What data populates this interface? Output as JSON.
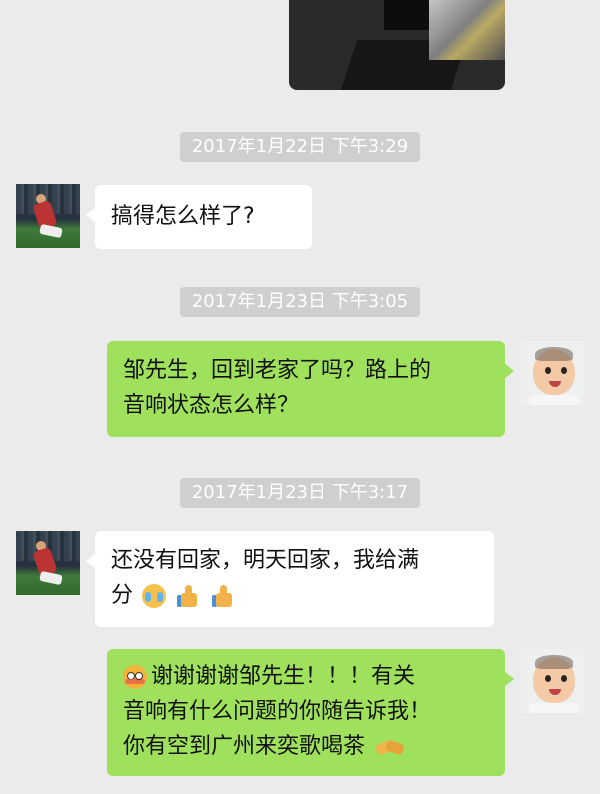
{
  "timestamps": [
    "2017年1月22日 下午3:29",
    "2017年1月23日 下午3:05",
    "2017年1月23日 下午3:17"
  ],
  "messages": [
    {
      "lines": [
        "搞得怎么样了?"
      ]
    },
    {
      "lines": [
        "邹先生，回到老家了吗？路上的",
        "音响状态怎么样？"
      ]
    },
    {
      "lines": [
        "还没有回家，明天回家，我给满",
        "分"
      ],
      "emojis": [
        "crying-laughing-icon",
        "thumbs-up-icon",
        "thumbs-up-icon"
      ]
    },
    {
      "lines": [
        "谢谢谢谢邹先生！！！有关",
        "音响有什么问题的你随告诉我！",
        "你有空到广州来奕歌喝茶"
      ],
      "emojis": [
        "flushed-face-icon",
        "handshake-icon"
      ]
    }
  ],
  "colors": {
    "background": "#ebebeb",
    "incoming_bubble": "#ffffff",
    "outgoing_bubble": "#9fe15d",
    "timestamp_bg": "#cfcfcf"
  }
}
